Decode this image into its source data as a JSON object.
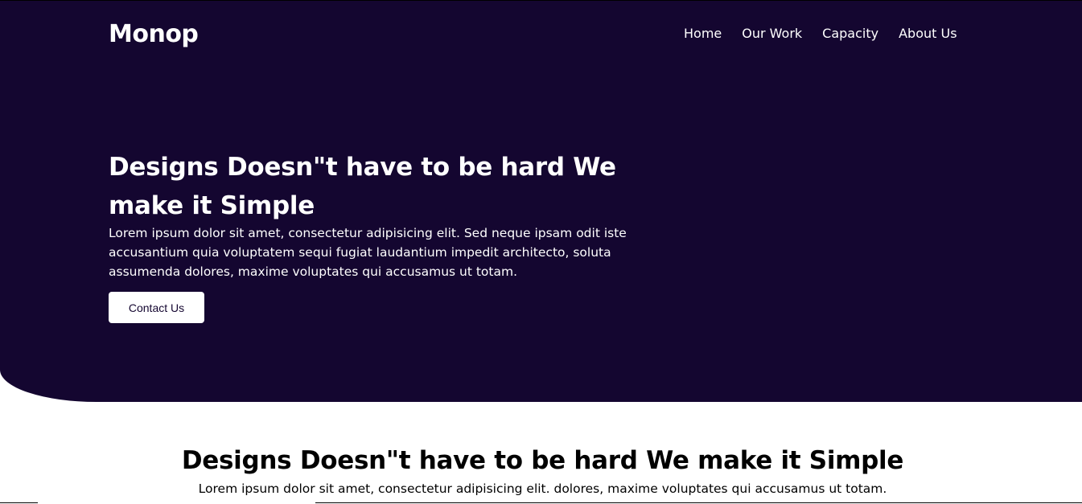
{
  "brand": {
    "logo": "Monop"
  },
  "nav": {
    "items": [
      "Home",
      "Our Work",
      "Capacity",
      "About Us"
    ]
  },
  "hero": {
    "title": "Designs Doesn\"t have to be hard We make it Simple",
    "text": "Lorem ipsum dolor sit amet, consectetur adipisicing elit. Sed neque ipsam odit iste accusantium quia voluptatem sequi fugiat laudantium impedit architecto, soluta assumenda dolores, maxime voluptates qui accusamus ut totam.",
    "button_label": "Contact Us"
  },
  "section": {
    "title": "Designs Doesn\"t have to be hard We make it Simple",
    "text": "Lorem ipsum dolor sit amet, consectetur adipisicing elit. dolores, maxime voluptates qui accusamus ut totam."
  },
  "colors": {
    "hero_bg": "#140630",
    "text_light": "#ffffff",
    "text_dark": "#000000"
  }
}
